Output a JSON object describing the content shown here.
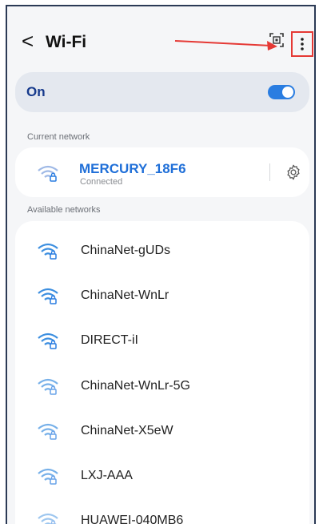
{
  "header": {
    "back_glyph": "<",
    "title": "Wi-Fi"
  },
  "wifi_toggle": {
    "label": "On",
    "state": "on",
    "accent": "#2a7de1"
  },
  "current": {
    "section_label": "Current network",
    "ssid": "MERCURY_18F6",
    "status": "Connected"
  },
  "available": {
    "section_label": "Available networks",
    "networks": [
      {
        "ssid": "ChinaNet-gUDs"
      },
      {
        "ssid": "ChinaNet-WnLr"
      },
      {
        "ssid": "DIRECT-iI"
      },
      {
        "ssid": "ChinaNet-WnLr-5G"
      },
      {
        "ssid": "ChinaNet-X5eW"
      },
      {
        "ssid": "LXJ-AAA"
      },
      {
        "ssid": "HUAWEI-040MB6"
      }
    ]
  },
  "icons": {
    "back": "chevron-left-icon",
    "qr": "qr-scan-icon",
    "more": "more-vertical-icon",
    "settings": "gear-icon",
    "wifi_locked": "wifi-lock-icon"
  },
  "colors": {
    "highlight": "#e53935",
    "link": "#1f6fd8"
  }
}
